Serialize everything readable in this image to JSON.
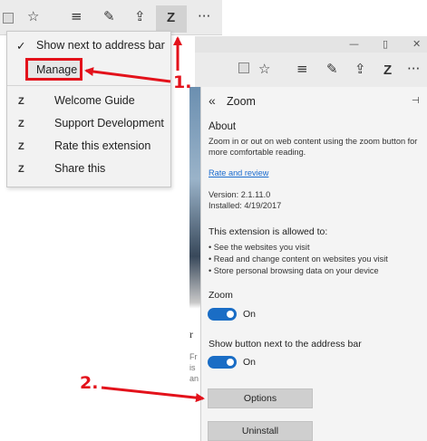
{
  "toolbar": {
    "icons": [
      "reading-view-icon",
      "favorites-star-icon",
      "hub-icon",
      "web-note-pen-icon",
      "share-icon",
      "zoom-extension-icon",
      "more-icon"
    ],
    "zoom_glyph": "Z",
    "more_glyph": "···"
  },
  "context_menu": {
    "show_next": "Show next to address bar",
    "check_glyph": "✓",
    "manage": "Manage",
    "items": [
      "Welcome Guide",
      "Support Development",
      "Rate this extension",
      "Share this"
    ]
  },
  "window": {
    "minimize_glyph": "—",
    "restore_glyph": "▯",
    "close_glyph": "✕"
  },
  "pane": {
    "back_glyph": "«",
    "title": "Zoom",
    "pin_glyph": "⊣",
    "about_heading": "About",
    "about_text": "Zoom in or out on web content using the zoom button for more comfortable reading.",
    "rate_link": "Rate and review",
    "version": "Version: 2.1.11.0",
    "installed": "Installed: 4/19/2017",
    "allowed_heading": "This extension is allowed to:",
    "permissions": [
      "See the websites you visit",
      "Read and change content on websites you visit",
      "Store personal browsing data on your device"
    ],
    "zoom_heading": "Zoom",
    "zoom_toggle_label": "On",
    "show_button_heading": "Show button next to the address bar",
    "show_button_toggle_label": "On",
    "options_button": "Options",
    "uninstall_button": "Uninstall"
  },
  "annotations": {
    "step1": "1.",
    "step2": "2."
  },
  "background_text": [
    "r",
    "Fr",
    "is",
    "an"
  ],
  "colors": {
    "accent": "#1a6dc5",
    "annotation_red": "#e3121b",
    "link": "#1a6ccf"
  }
}
